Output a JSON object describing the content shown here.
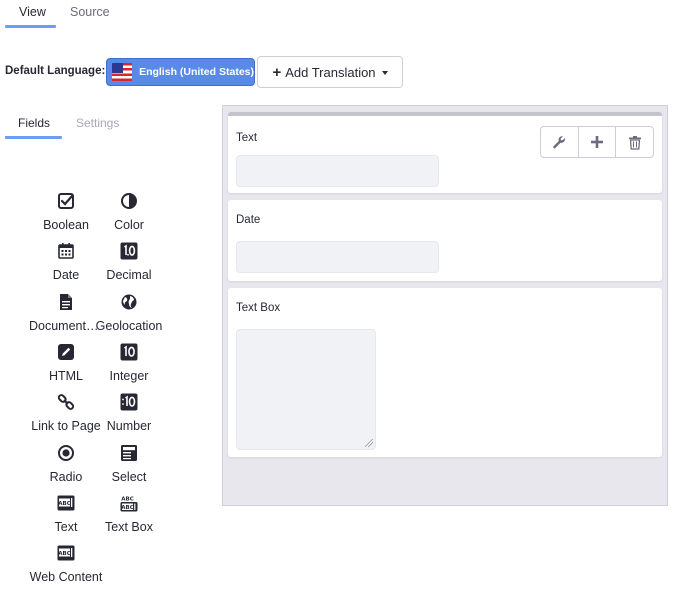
{
  "top_tabs": {
    "view": "View",
    "source": "Source"
  },
  "language": {
    "label": "Default Language:",
    "selected": "English (United States)",
    "add_translation": "Add Translation"
  },
  "sidebar": {
    "tabs": {
      "fields": "Fields",
      "settings": "Settings"
    },
    "fields": [
      {
        "label": "Boolean",
        "icon": "checkbox-icon"
      },
      {
        "label": "Color",
        "icon": "contrast-icon"
      },
      {
        "label": "Date",
        "icon": "calendar-icon"
      },
      {
        "label": "Decimal",
        "icon": "decimal-icon"
      },
      {
        "label": "Documents and Media",
        "icon": "document-icon"
      },
      {
        "label": "Geolocation",
        "icon": "globe-icon"
      },
      {
        "label": "HTML",
        "icon": "pencil-icon"
      },
      {
        "label": "Integer",
        "icon": "integer-icon"
      },
      {
        "label": "Link to Page",
        "icon": "link-icon"
      },
      {
        "label": "Number",
        "icon": "number-icon"
      },
      {
        "label": "Radio",
        "icon": "radio-icon"
      },
      {
        "label": "Select",
        "icon": "select-icon"
      },
      {
        "label": "Text",
        "icon": "text-icon"
      },
      {
        "label": "Text Box",
        "icon": "textbox-icon"
      },
      {
        "label": "Web Content",
        "icon": "web-content-icon"
      }
    ]
  },
  "canvas": {
    "fields": [
      {
        "label": "Text",
        "type": "text"
      },
      {
        "label": "Date",
        "type": "date"
      },
      {
        "label": "Text Box",
        "type": "textarea"
      }
    ],
    "toolbar": [
      "wrench-icon",
      "plus-icon",
      "trash-icon"
    ]
  },
  "colors": {
    "accent": "#6d9ef1",
    "primary_button": "#5a8ae8",
    "canvas_bg": "#e7e7ed"
  }
}
